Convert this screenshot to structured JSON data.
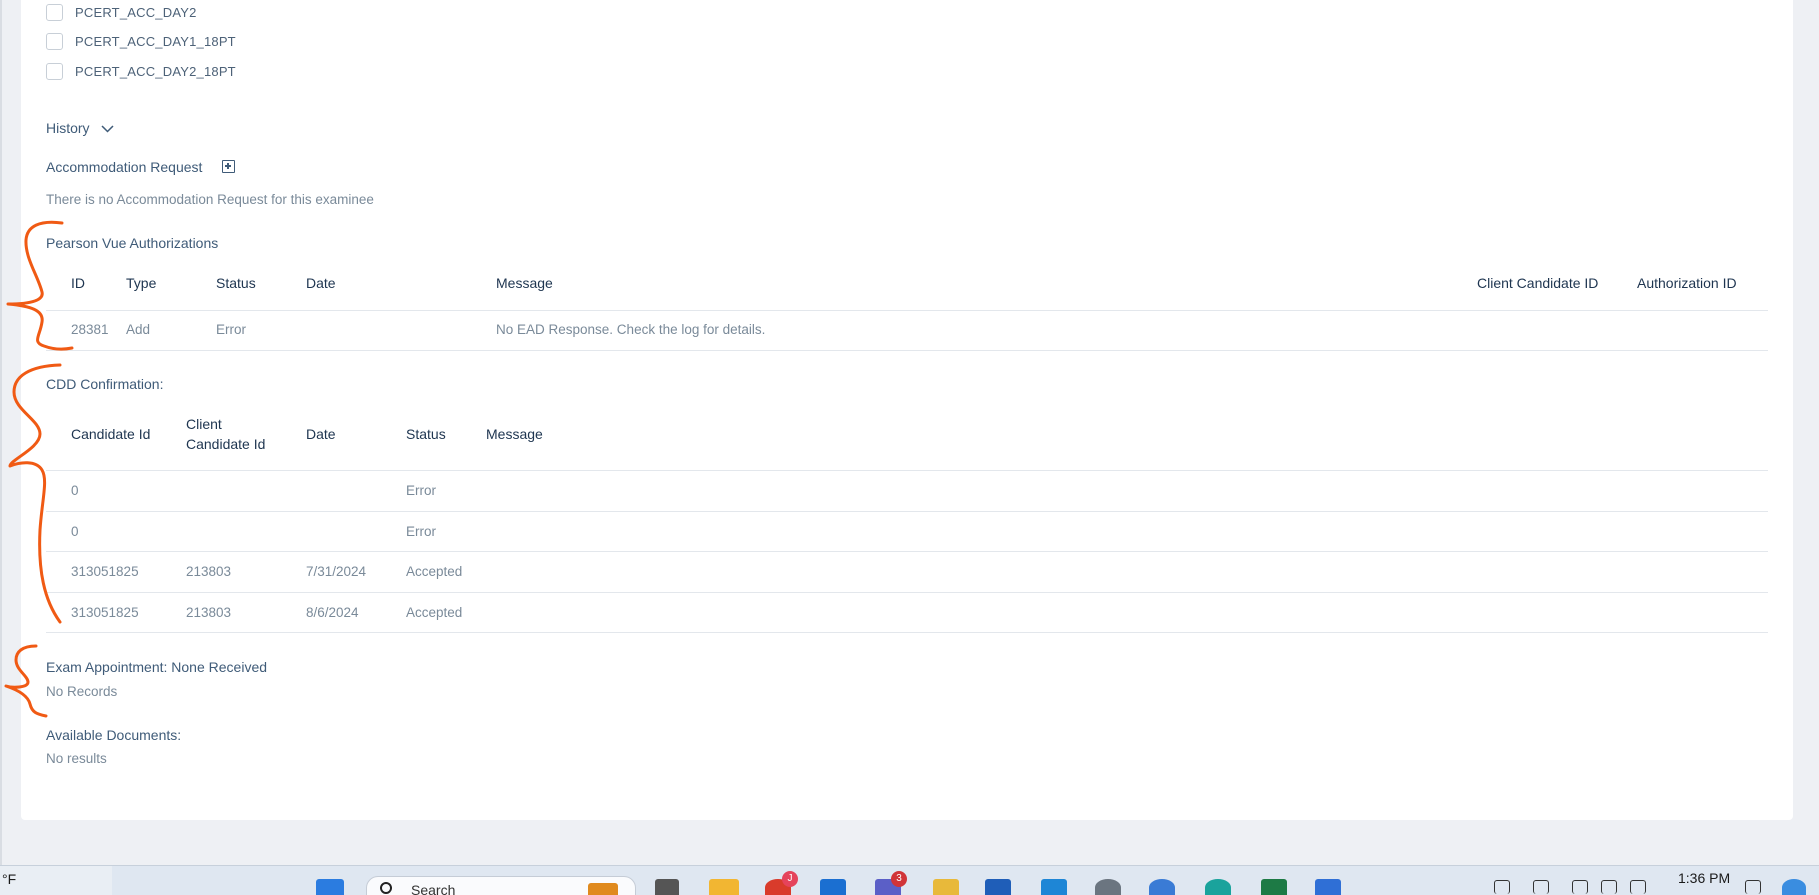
{
  "checkboxes": [
    {
      "label": "PCERT_ACC_DAY2",
      "checked": false
    },
    {
      "label": "PCERT_ACC_DAY1_18PT",
      "checked": false
    },
    {
      "label": "PCERT_ACC_DAY2_18PT",
      "checked": false
    }
  ],
  "history": {
    "label": "History"
  },
  "accommodation": {
    "title": "Accommodation Request",
    "empty_text": "There is no Accommodation Request for this examinee"
  },
  "pearson": {
    "title": "Pearson Vue Authorizations",
    "headers": [
      "ID",
      "Type",
      "Status",
      "Date",
      "Message",
      "Client Candidate ID",
      "Authorization ID"
    ],
    "rows": [
      {
        "id": "28381",
        "type": "Add",
        "status": "Error",
        "date": "",
        "message": "No EAD Response. Check the log for details.",
        "client_candidate_id": "",
        "authorization_id": ""
      }
    ]
  },
  "cdd": {
    "title": "CDD Confirmation:",
    "headers": {
      "candidate_id": "Candidate Id",
      "client_candidate_id_line1": "Client",
      "client_candidate_id_line2": "Candidate Id",
      "date": "Date",
      "status": "Status",
      "message": "Message"
    },
    "rows": [
      {
        "candidate_id": "0",
        "client_candidate_id": "",
        "date": "",
        "status": "Error",
        "message": ""
      },
      {
        "candidate_id": "0",
        "client_candidate_id": "",
        "date": "",
        "status": "Error",
        "message": ""
      },
      {
        "candidate_id": "313051825",
        "client_candidate_id": "213803",
        "date": "7/31/2024",
        "status": "Accepted",
        "message": ""
      },
      {
        "candidate_id": "313051825",
        "client_candidate_id": "213803",
        "date": "8/6/2024",
        "status": "Accepted",
        "message": ""
      }
    ]
  },
  "exam_appointment": {
    "title": "Exam Appointment: None Received",
    "empty_text": "No Records"
  },
  "documents": {
    "title": "Available Documents:",
    "empty_text": "No results"
  },
  "taskbar": {
    "weather_fragment": "°F",
    "search_placeholder": "Search",
    "time": "1:36 PM",
    "badges": {
      "chrome": "J",
      "teams": "3"
    }
  },
  "colors": {
    "annotation": "#f05a14",
    "heading": "#3f5b78",
    "table_header": "#1e3550",
    "muted": "#7a8a99"
  }
}
